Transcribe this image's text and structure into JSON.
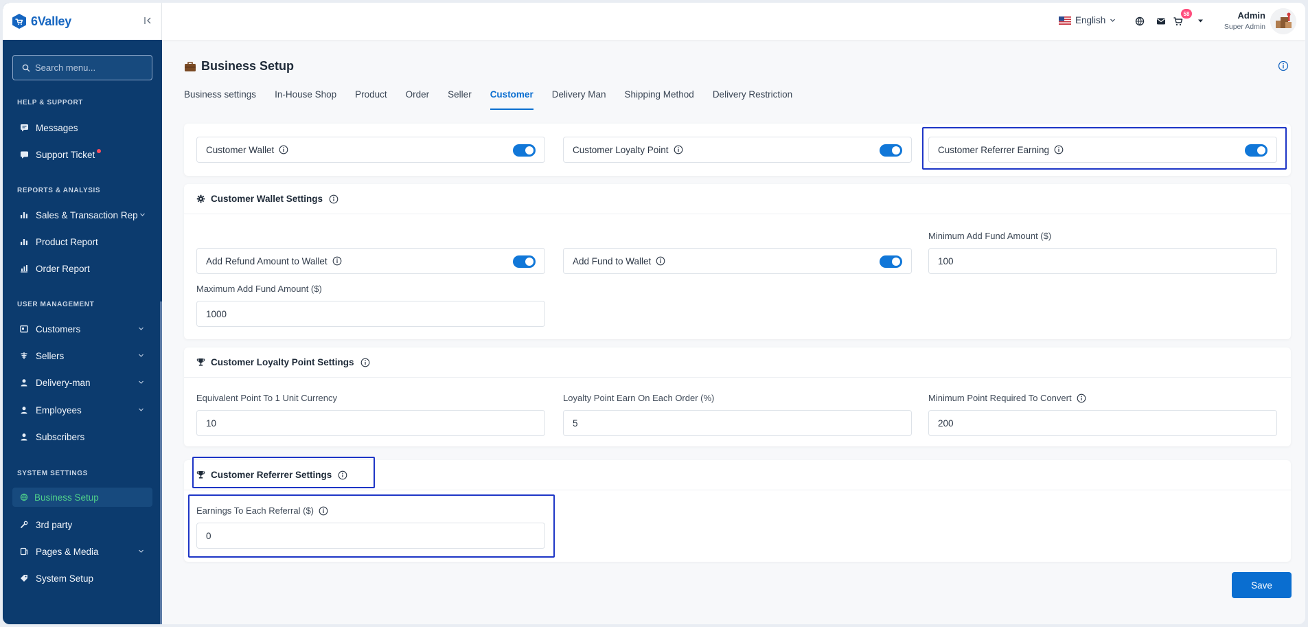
{
  "brand": {
    "name": "6Valley"
  },
  "sidebar": {
    "search_placeholder": "Search menu...",
    "sections": {
      "help": "HELP & SUPPORT",
      "reports": "REPORTS & ANALYSIS",
      "users": "USER MANAGEMENT",
      "system": "SYSTEM SETTINGS"
    },
    "items": {
      "messages": "Messages",
      "support_ticket": "Support Ticket",
      "sales_report": "Sales & Transaction Rep",
      "product_report": "Product Report",
      "order_report": "Order Report",
      "customers": "Customers",
      "sellers": "Sellers",
      "delivery_man": "Delivery-man",
      "employees": "Employees",
      "subscribers": "Subscribers",
      "business_setup": "Business Setup",
      "third_party": "3rd party",
      "pages_media": "Pages & Media",
      "system_setup": "System Setup"
    }
  },
  "topbar": {
    "language": "English",
    "cart_count": "58",
    "admin_name": "Admin",
    "admin_role": "Super Admin"
  },
  "page": {
    "title": "Business Setup",
    "tabs": [
      "Business settings",
      "In-House Shop",
      "Product",
      "Order",
      "Seller",
      "Customer",
      "Delivery Man",
      "Shipping Method",
      "Delivery Restriction"
    ],
    "active_tab": "Customer"
  },
  "toggles_card": {
    "customer_wallet": {
      "label": "Customer Wallet",
      "enabled": true
    },
    "customer_loyalty_point": {
      "label": "Customer Loyalty Point",
      "enabled": true
    },
    "customer_referrer_earning": {
      "label": "Customer Referrer Earning",
      "enabled": true
    }
  },
  "wallet_settings": {
    "title": "Customer Wallet Settings",
    "add_refund": {
      "label": "Add Refund Amount to Wallet",
      "enabled": true
    },
    "add_fund": {
      "label": "Add Fund to Wallet",
      "enabled": true
    },
    "min_add_fund": {
      "label": "Minimum Add Fund Amount ($)",
      "value": "100"
    },
    "max_add_fund": {
      "label": "Maximum Add Fund Amount ($)",
      "value": "1000"
    }
  },
  "loyalty_settings": {
    "title": "Customer Loyalty Point Settings",
    "equivalent_point": {
      "label": "Equivalent Point To 1 Unit Currency",
      "value": "10"
    },
    "earn_each_order": {
      "label": "Loyalty Point Earn On Each Order (%)",
      "value": "5"
    },
    "min_point": {
      "label": "Minimum Point Required To Convert",
      "value": "200"
    }
  },
  "referrer_settings": {
    "title": "Customer Referrer Settings",
    "earnings_each_referral": {
      "label": "Earnings To Each Referral ($)",
      "value": "0"
    }
  },
  "actions": {
    "save": "Save"
  },
  "colors": {
    "primary": "#0a6ed0",
    "sidebar": "#0c3b6e",
    "active_nav": "#4fd08b",
    "highlight": "#1d35c6"
  }
}
